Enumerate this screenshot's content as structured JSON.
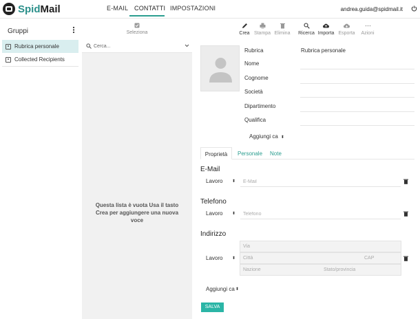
{
  "app": {
    "name_part1": "Spid",
    "name_part2": "Mail"
  },
  "nav": {
    "email": "E-MAIL",
    "contatti": "CONTATTI",
    "impostazioni": "IMPOSTAZIONI"
  },
  "user": {
    "email": "andrea.guida@spidmail.it"
  },
  "groups": {
    "title": "Gruppi",
    "items": [
      {
        "label": "Rubrica personale"
      },
      {
        "label": "Collected Recipients"
      }
    ]
  },
  "list": {
    "select_label": "Seleziona",
    "search_placeholder": "Cerca...",
    "empty_message": "Questa lista è vuota Usa il tasto Crea per aggiungere una nuova voce"
  },
  "toolbar": {
    "crea": "Crea",
    "stampa": "Stampa",
    "elimina": "Elimina",
    "ricerca": "Ricerca",
    "importa": "Importa",
    "esporta": "Esporta",
    "azioni": "Azioni"
  },
  "form": {
    "labels": {
      "rubrica": "Rubrica",
      "nome": "Nome",
      "cognome": "Cognome",
      "societa": "Società",
      "dipartimento": "Dipartimento",
      "qualifica": "Qualifica"
    },
    "rubrica_value": "Rubrica personale",
    "add_field_top": "Aggiungi ca",
    "tabs": {
      "proprieta": "Proprietà",
      "personale": "Personale",
      "note": "Note"
    },
    "email": {
      "title": "E-Mail",
      "type": "Lavoro",
      "placeholder": "E-Mail"
    },
    "phone": {
      "title": "Telefono",
      "type": "Lavoro",
      "placeholder": "Telefono"
    },
    "address": {
      "title": "Indirizzo",
      "type": "Lavoro",
      "via": "Via",
      "citta": "Città",
      "cap": "CAP",
      "nazione": "Nazione",
      "stato": "Stato/provincia"
    },
    "add_field_bottom": "Aggiungi ca",
    "save": "SALVA"
  },
  "colors": {
    "accent": "#2a9d8f",
    "save_button": "#2bb5a6",
    "selected_group": "#d9eeef",
    "list_bg": "#f1f1f1"
  }
}
